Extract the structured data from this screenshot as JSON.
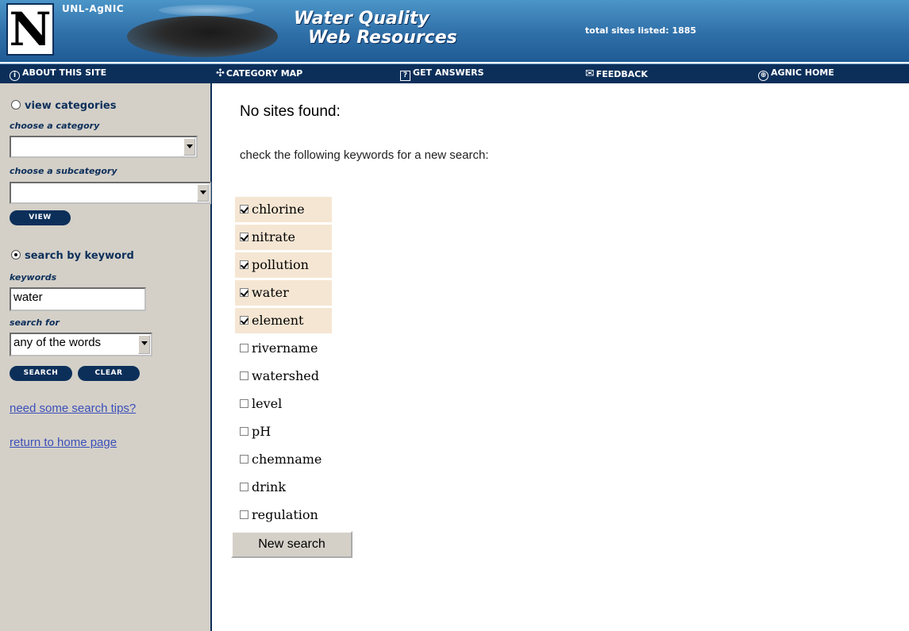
{
  "header": {
    "org": "UNL-AgNIC",
    "logo_letter": "N",
    "title_line1": "Water Quality",
    "title_line2": "Web Resources",
    "total_sites": "total sites listed: 1885"
  },
  "nav": {
    "items": [
      {
        "label": "ABOUT THIS SITE",
        "icon": "info-icon"
      },
      {
        "label": "CATEGORY MAP",
        "icon": "map-arrows-icon"
      },
      {
        "label": "GET ANSWERS",
        "icon": "question-icon"
      },
      {
        "label": "FEEDBACK",
        "icon": "envelope-icon"
      },
      {
        "label": "AGNIC HOME",
        "icon": "globe-icon"
      }
    ]
  },
  "sidebar": {
    "view_categories": "view categories",
    "choose_category": "choose a category",
    "category_value": "",
    "choose_subcategory": "choose a subcategory",
    "subcategory_value": "",
    "view_button": "VIEW",
    "search_by_keyword": "search by keyword",
    "keywords_label": "keywords",
    "keywords_value": "water",
    "search_for_label": "search for",
    "search_for_value": "any of the words",
    "search_button": "SEARCH",
    "clear_button": "CLEAR",
    "tips_link": "need some search tips?",
    "home_link": "return to home page",
    "mode": "keyword"
  },
  "main": {
    "title": "No sites found:",
    "subtitle": "check the following keywords for a new search:",
    "keywords": [
      {
        "word": "chlorine",
        "checked": true
      },
      {
        "word": "nitrate",
        "checked": true
      },
      {
        "word": "pollution",
        "checked": true
      },
      {
        "word": "water",
        "checked": true
      },
      {
        "word": "element",
        "checked": true
      },
      {
        "word": "rivername",
        "checked": false
      },
      {
        "word": "watershed",
        "checked": false
      },
      {
        "word": "level",
        "checked": false
      },
      {
        "word": "pH",
        "checked": false
      },
      {
        "word": "chemname",
        "checked": false
      },
      {
        "word": "drink",
        "checked": false
      },
      {
        "word": "regulation",
        "checked": false
      }
    ],
    "new_search_button": "New search"
  },
  "colors": {
    "header_blue": "#2f6fa8",
    "nav_navy": "#0c2f5a",
    "sidebar_gray": "#d4d0c8",
    "checked_row_bg": "#f5e6d3",
    "link_blue": "#3b4fb8"
  }
}
